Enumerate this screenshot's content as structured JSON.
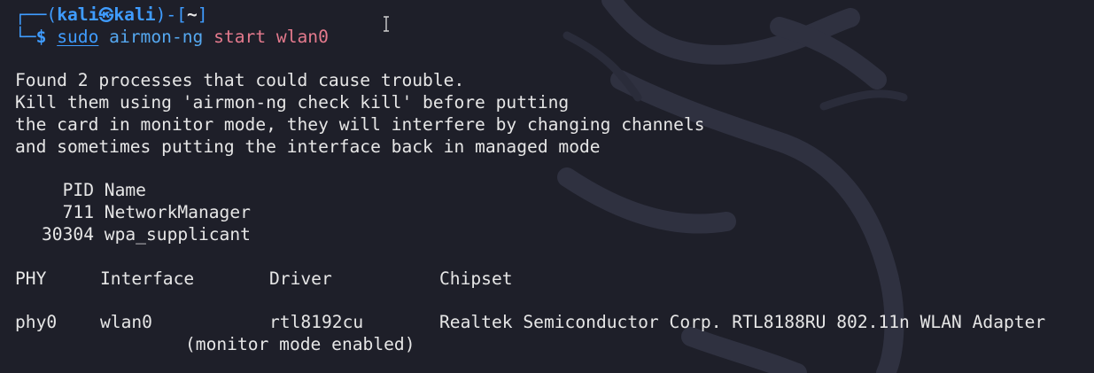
{
  "prompt": {
    "open1": "┌──(",
    "user": "kali",
    "skull": "㉿",
    "host": "kali",
    "close1": ")-[",
    "dir": "~",
    "close2": "]",
    "corner": "└─",
    "dollar": "$",
    "sudo": "sudo",
    "program": "airmon-ng",
    "args": "start wlan0"
  },
  "messages": [
    "Found 2 processes that could cause trouble.",
    "Kill them using 'airmon-ng check kill' before putting",
    "the card in monitor mode, they will interfere by changing channels",
    "and sometimes putting the interface back in managed mode"
  ],
  "process_table": {
    "headers": [
      "PID",
      "Name"
    ],
    "rows": [
      {
        "pid": "711",
        "name": "NetworkManager"
      },
      {
        "pid": "30304",
        "name": "wpa_supplicant"
      }
    ]
  },
  "interface_table": {
    "headers": [
      "PHY",
      "Interface",
      "Driver",
      "Chipset"
    ],
    "rows": [
      {
        "phy": "phy0",
        "interface": "wlan0",
        "driver": "rtl8192cu",
        "chipset": "Realtek Semiconductor Corp. RTL8188RU 802.11n WLAN Adapter"
      }
    ],
    "note": "(monitor mode enabled)"
  },
  "colors": {
    "background": "#1e1f29",
    "prompt_blue": "#3f9cff",
    "args_pink": "#e47a8d",
    "text": "#e6e6e6"
  },
  "icons": [
    "kali-dragon-watermark",
    "text-cursor-icon"
  ]
}
